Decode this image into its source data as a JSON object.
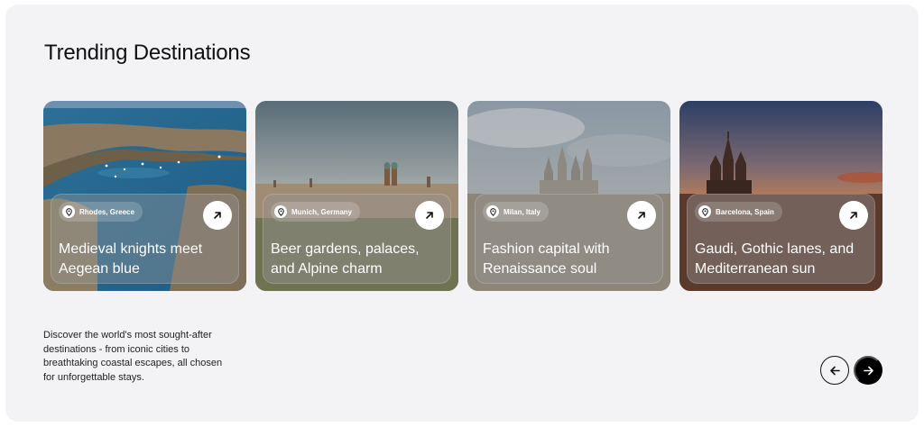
{
  "section": {
    "title": "Trending Destinations",
    "description": "Discover the world's most sought-after destinations - from iconic cities to breathtaking coastal escapes, all chosen for unforgettable stays."
  },
  "cards": [
    {
      "location": "Rhodes, Greece",
      "caption": "Medieval knights meet Aegean blue",
      "icon": "arrow-up-right-icon"
    },
    {
      "location": "Munich, Germany",
      "caption": "Beer gardens, palaces, and Alpine charm",
      "icon": "arrow-up-right-icon"
    },
    {
      "location": "Milan, Italy",
      "caption": "Fashion capital with Renaissance soul",
      "icon": "arrow-up-right-icon"
    },
    {
      "location": "Barcelona, Spain",
      "caption": "Gaudi, Gothic lanes, and Mediterranean sun",
      "icon": "arrow-up-right-icon"
    }
  ],
  "navigation": {
    "prev_icon": "arrow-left-icon",
    "next_icon": "arrow-right-icon"
  },
  "colors": {
    "panel_bg": "#f3f3f5",
    "text": "#111111",
    "next_button": "#000000"
  }
}
